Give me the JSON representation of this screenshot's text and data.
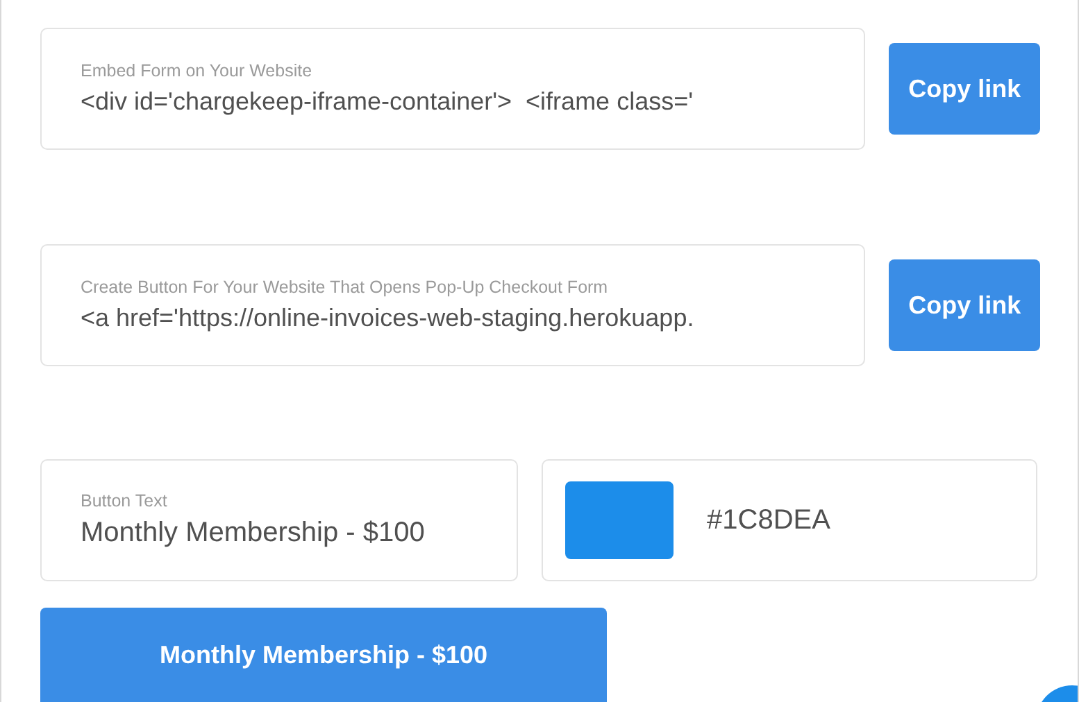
{
  "embed_field": {
    "label": "Embed Form on Your Website",
    "value": "<div id='chargekeep-iframe-container'>  <iframe class='",
    "button": "Copy link"
  },
  "popup_field": {
    "label": "Create Button For Your Website That Opens Pop-Up Checkout Form",
    "value": "<a href='https://online-invoices-web-staging.herokuapp.",
    "button": "Copy link"
  },
  "button_text_field": {
    "label": "Button Text",
    "value": "Monthly Membership - $100"
  },
  "color_field": {
    "value": "#1C8DEA"
  },
  "preview_button": {
    "label": "Monthly Membership - $100"
  }
}
